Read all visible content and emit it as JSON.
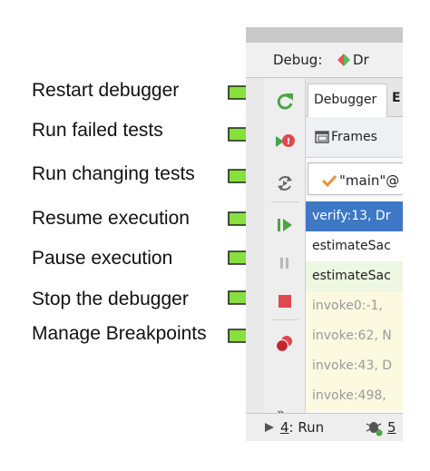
{
  "callouts": [
    {
      "label": "Restart debugger"
    },
    {
      "label": "Run failed tests"
    },
    {
      "label": "Run changing tests"
    },
    {
      "label": "Resume execution"
    },
    {
      "label": "Pause execution"
    },
    {
      "label": "Stop the debugger"
    },
    {
      "label": "Manage Breakpoints"
    }
  ],
  "header": {
    "debug_label": "Debug:",
    "dr_tab": "Dr"
  },
  "toolbar": {
    "icons": [
      "restart-icon",
      "run-failed-tests-icon",
      "run-changing-tests-icon",
      "resume-icon",
      "pause-icon",
      "stop-icon",
      "breakpoints-icon"
    ],
    "more": "»"
  },
  "panel": {
    "tab_debugger": "Debugger",
    "tab_more": "E",
    "frames_label": "Frames",
    "thread_label": "\"main\"@",
    "frames": [
      {
        "text": "verify:13, Dr",
        "state": "selected"
      },
      {
        "text": "estimateSac",
        "state": "normal"
      },
      {
        "text": "estimateSac",
        "state": "highlight"
      },
      {
        "text": "invoke0:-1,",
        "state": "dim"
      },
      {
        "text": "invoke:62, N",
        "state": "dim"
      },
      {
        "text": "invoke:43, D",
        "state": "dim"
      },
      {
        "text": "invoke:498,",
        "state": "dim"
      }
    ]
  },
  "bottom": {
    "run_num": "4",
    "run_label": ": Run",
    "bug_num": "5"
  },
  "colors": {
    "arrow_fill": "#88e03c",
    "arrow_stroke": "#222222",
    "selected_bg": "#3c78c6",
    "highlight_bg": "#eef7e1",
    "dim_bg": "#fbf9e0"
  }
}
